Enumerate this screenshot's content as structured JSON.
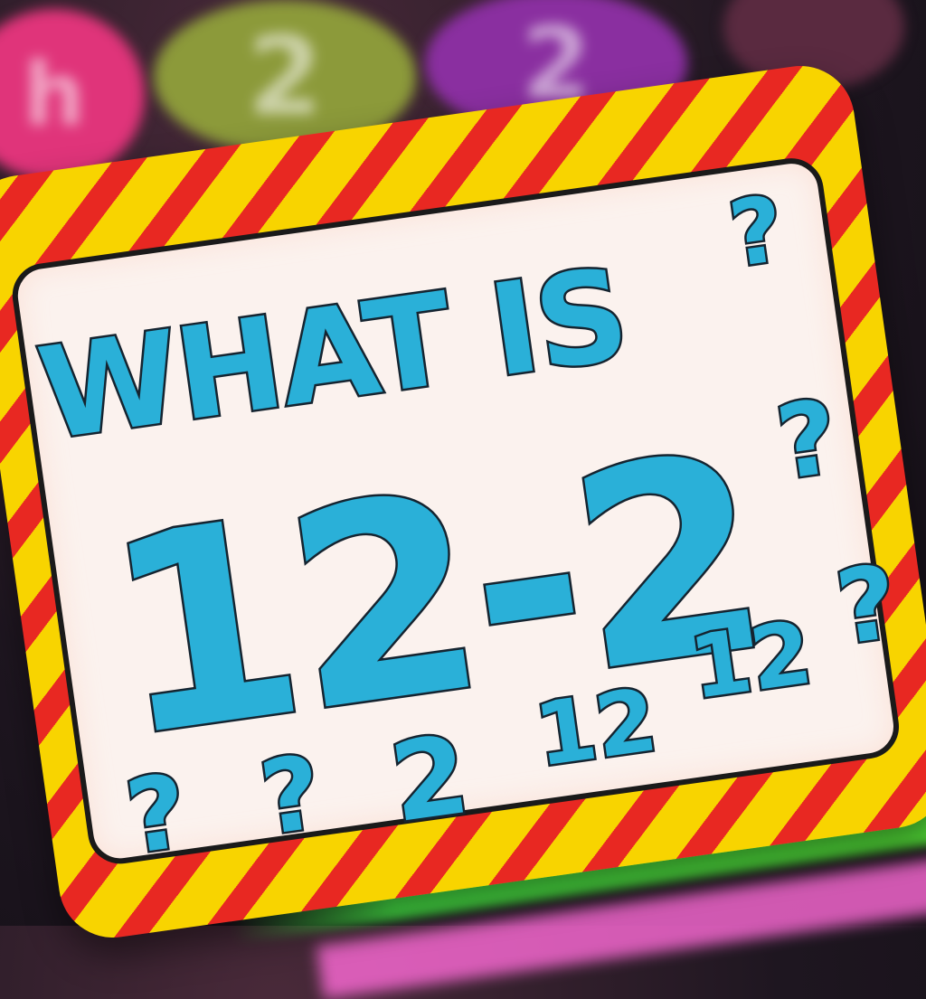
{
  "background": {
    "balls": [
      "h",
      "2",
      "2"
    ]
  },
  "sign": {
    "headline": "WHAT IS",
    "equation": "12-2",
    "question_marks": [
      "?",
      "?",
      "?",
      "?",
      "?"
    ],
    "scattered_numbers": [
      "2",
      "12",
      "12"
    ]
  },
  "colors": {
    "text_fill": "#2ab0d8",
    "text_outline": "#152430",
    "stripe_yellow": "#f8d400",
    "stripe_red": "#e82822",
    "panel": "#fbf2ee"
  }
}
